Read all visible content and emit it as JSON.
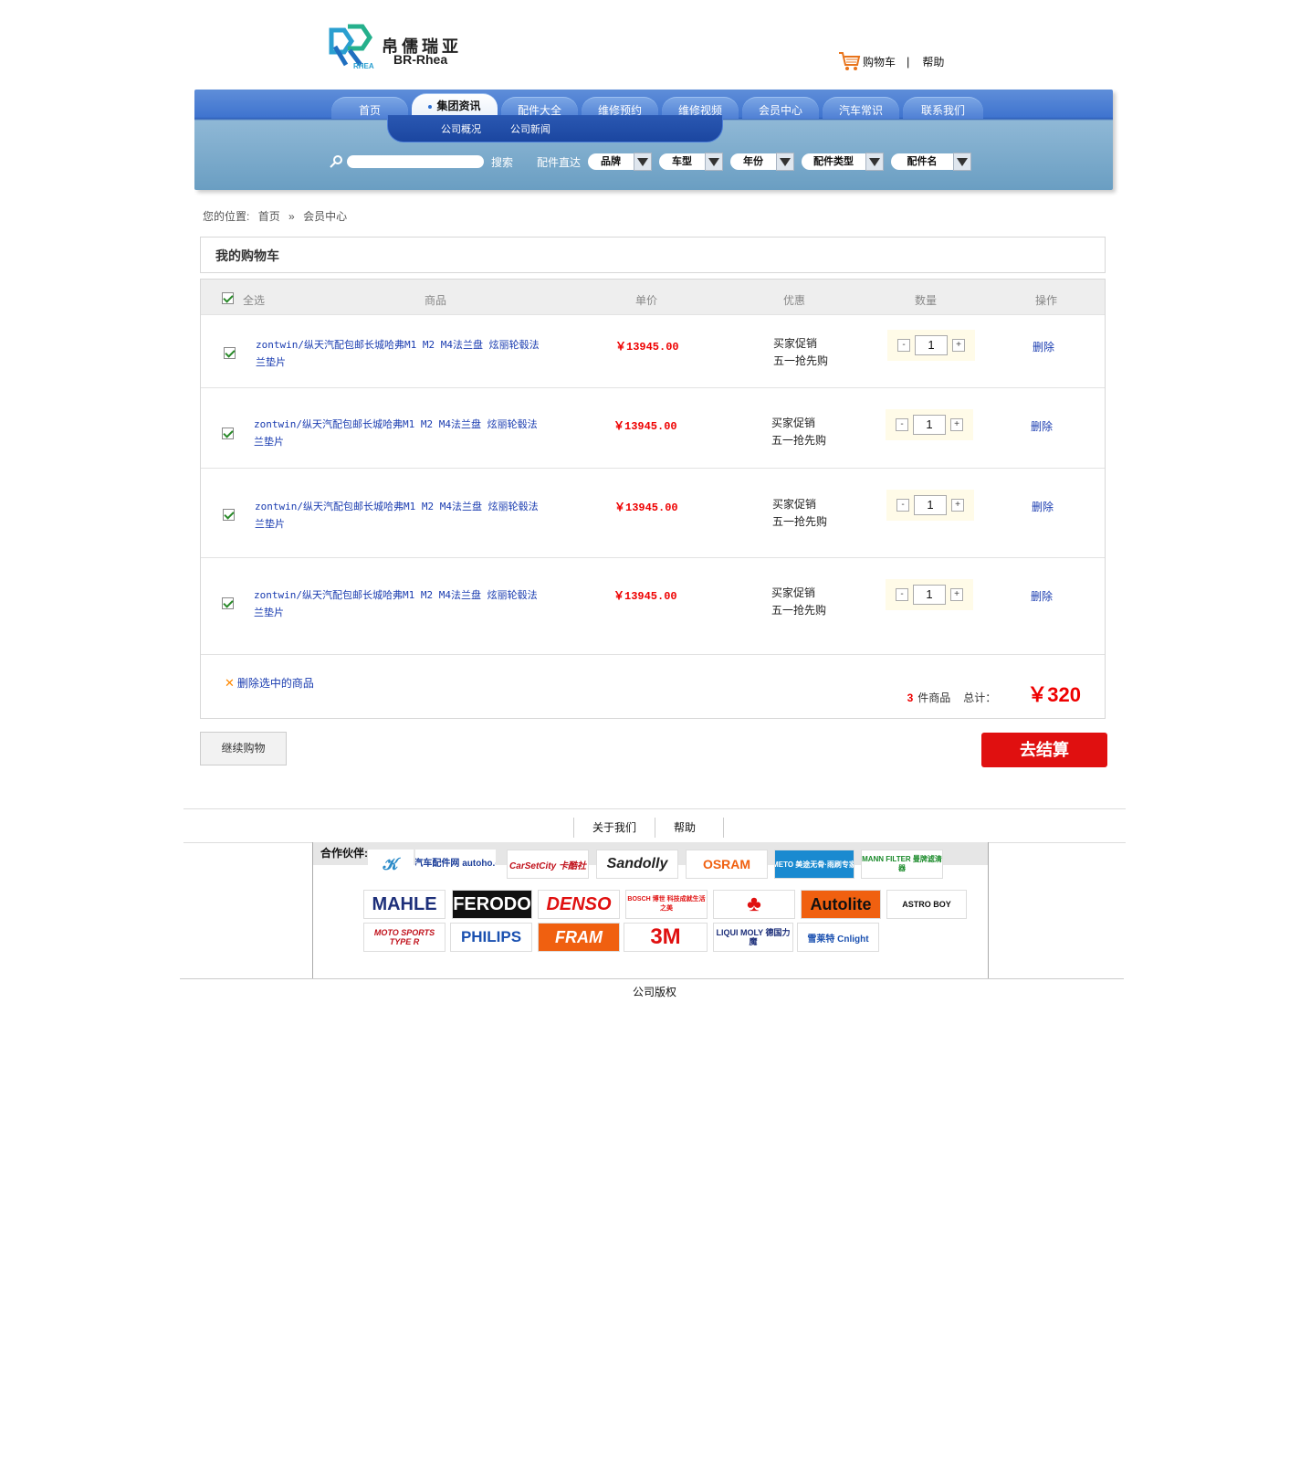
{
  "header": {
    "brand_cn": "帛儒瑞亚",
    "brand_en": "BR-Rhea",
    "logo_mark": "RHEA",
    "cart_label": "购物车",
    "separator": "|",
    "help_label": "帮助"
  },
  "nav": {
    "tabs": [
      "首页",
      "集团资讯",
      "配件大全",
      "维修预约",
      "维修视频",
      "会员中心",
      "汽车常识",
      "联系我们"
    ],
    "active_tab": "集团资讯",
    "subnav": [
      "公司概况",
      "公司新闻"
    ],
    "search_label": "搜索",
    "direct_label": "配件直达",
    "filters": [
      "品牌",
      "车型",
      "年份",
      "配件类型",
      "配件名"
    ]
  },
  "breadcrumb": {
    "prefix": "您的位置:",
    "home": "首页",
    "sep": "»",
    "current": "会员中心"
  },
  "cart": {
    "title": "我的购物车",
    "headers": {
      "select_all": "全选",
      "product": "商品",
      "unit_price": "单价",
      "promotion": "优惠",
      "quantity": "数量",
      "action": "操作"
    },
    "items": [
      {
        "name_line1": "zontwin/纵天汽配包邮长城哈弗M1 M2 M4法兰盘 炫丽轮毂法",
        "name_line2": "兰垫片",
        "price": "￥13945.00",
        "promo1": "买家促销",
        "promo2": "五一抢先购",
        "qty": "1",
        "minus": "-",
        "plus": "+",
        "delete": "删除"
      },
      {
        "name_line1": "zontwin/纵天汽配包邮长城哈弗M1 M2 M4法兰盘 炫丽轮毂法",
        "name_line2": "兰垫片",
        "price": "￥13945.00",
        "promo1": "买家促销",
        "promo2": "五一抢先购",
        "qty": "1",
        "minus": "-",
        "plus": "+",
        "delete": "删除"
      },
      {
        "name_line1": "zontwin/纵天汽配包邮长城哈弗M1 M2 M4法兰盘 炫丽轮毂法",
        "name_line2": "兰垫片",
        "price": "￥13945.00",
        "promo1": "买家促销",
        "promo2": "五一抢先购",
        "qty": "1",
        "minus": "-",
        "plus": "+",
        "delete": "删除"
      },
      {
        "name_line1": "zontwin/纵天汽配包邮长城哈弗M1 M2 M4法兰盘 炫丽轮毂法",
        "name_line2": "兰垫片",
        "price": "￥13945.00",
        "promo1": "买家促销",
        "promo2": "五一抢先购",
        "qty": "1",
        "minus": "-",
        "plus": "+",
        "delete": "删除"
      }
    ],
    "delete_selected": "删除选中的商品",
    "count": "3",
    "count_suffix": "件商品",
    "total_label": "总计：",
    "total": "￥320",
    "continue_label": "继续购物",
    "checkout_label": "去结算"
  },
  "footer": {
    "links": [
      "关于我们",
      "帮助"
    ],
    "partners_title": "合作伙伴:",
    "partners": [
      "中国汽车配件网 autoho.cOm",
      "CarSetCity 卡酷社",
      "Sandolly",
      "OSRAM",
      "METO 美途无骨·雨刷专家",
      "MANN FILTER 曼牌滤清器",
      "MAHLE",
      "FERODO",
      "DENSO",
      "BOSCH 博世 科技成就生活之美",
      "Autolite",
      "ASTRO BOY",
      "MOTO SPORTS TYPE R",
      "PHILIPS",
      "FRAM",
      "3M",
      "LIQUI MOLY 德国力魔",
      "雪莱特 Cnlight"
    ],
    "copyright": "公司版权"
  },
  "colors": {
    "nav_blue": "#3f74cf",
    "price_red": "#e00000",
    "link_blue": "#1a3cb0",
    "checkout_red": "#e01010"
  }
}
